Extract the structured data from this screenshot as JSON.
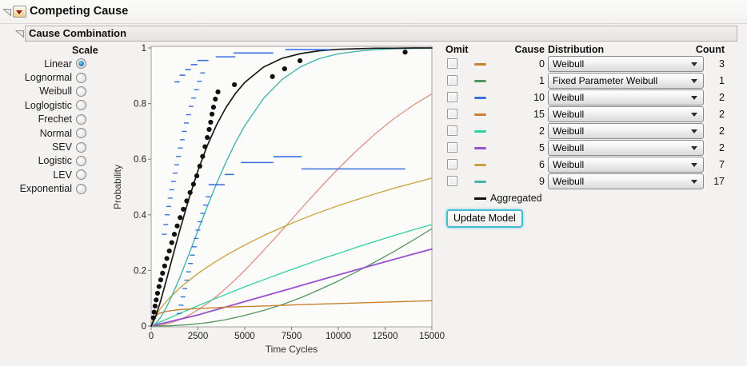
{
  "header": {
    "title": "Competing Cause"
  },
  "section": {
    "title": "Cause Combination"
  },
  "scale_panel": {
    "title": "Scale",
    "options": [
      {
        "label": "Linear",
        "selected": true
      },
      {
        "label": "Lognormal",
        "selected": false
      },
      {
        "label": "Weibull",
        "selected": false
      },
      {
        "label": "Loglogistic",
        "selected": false
      },
      {
        "label": "Frechet",
        "selected": false
      },
      {
        "label": "Normal",
        "selected": false
      },
      {
        "label": "SEV",
        "selected": false
      },
      {
        "label": "Logistic",
        "selected": false
      },
      {
        "label": "LEV",
        "selected": false
      },
      {
        "label": "Exponential",
        "selected": false
      }
    ]
  },
  "chart_data": {
    "type": "line",
    "xlabel": "Time Cycles",
    "ylabel": "Probability",
    "xlim": [
      0,
      15000
    ],
    "ylim": [
      0,
      1
    ],
    "xticks": [
      {
        "v": 0,
        "label": "0"
      },
      {
        "v": 2500,
        "label": "2500"
      },
      {
        "v": 5000,
        "label": "5000"
      },
      {
        "v": 7500,
        "label": "7500"
      },
      {
        "v": 10000,
        "label": "10000"
      },
      {
        "v": 12500,
        "label": "12500"
      },
      {
        "v": 15000,
        "label": "15000"
      }
    ],
    "yticks": [
      {
        "v": 0,
        "label": "0"
      },
      {
        "v": 0.2,
        "label": "0.2"
      },
      {
        "v": 0.4,
        "label": "0.4"
      },
      {
        "v": 0.6,
        "label": "0.6"
      },
      {
        "v": 0.8,
        "label": "0.8"
      },
      {
        "v": 1,
        "label": "1"
      }
    ],
    "grid": false,
    "series": [
      {
        "name": "Cause 15",
        "color": "#dd9282",
        "width": 1.3,
        "points": [
          [
            0,
            0
          ],
          [
            500,
            0.003
          ],
          [
            1000,
            0.01
          ],
          [
            1500,
            0.022
          ],
          [
            2000,
            0.038
          ],
          [
            2500,
            0.058
          ],
          [
            3000,
            0.081
          ],
          [
            3500,
            0.107
          ],
          [
            4000,
            0.136
          ],
          [
            4500,
            0.167
          ],
          [
            5000,
            0.2
          ],
          [
            6000,
            0.271
          ],
          [
            7000,
            0.345
          ],
          [
            8000,
            0.421
          ],
          [
            9000,
            0.495
          ],
          [
            10000,
            0.566
          ],
          [
            11000,
            0.632
          ],
          [
            12000,
            0.693
          ],
          [
            13000,
            0.747
          ],
          [
            14000,
            0.794
          ],
          [
            15000,
            0.835
          ]
        ]
      },
      {
        "name": "Cause 6",
        "color": "#c9a23d",
        "width": 1.3,
        "points": [
          [
            0,
            0
          ],
          [
            250,
            0.039
          ],
          [
            500,
            0.063
          ],
          [
            750,
            0.084
          ],
          [
            1000,
            0.102
          ],
          [
            1500,
            0.135
          ],
          [
            2000,
            0.163
          ],
          [
            2500,
            0.189
          ],
          [
            3000,
            0.212
          ],
          [
            3500,
            0.234
          ],
          [
            4000,
            0.254
          ],
          [
            4500,
            0.273
          ],
          [
            5000,
            0.291
          ],
          [
            6000,
            0.325
          ],
          [
            7000,
            0.355
          ],
          [
            8000,
            0.383
          ],
          [
            9000,
            0.409
          ],
          [
            10000,
            0.433
          ],
          [
            11000,
            0.455
          ],
          [
            12000,
            0.476
          ],
          [
            13000,
            0.496
          ],
          [
            14000,
            0.514
          ],
          [
            15000,
            0.532
          ]
        ]
      },
      {
        "name": "Cause 1",
        "color": "#55955b",
        "width": 1.3,
        "points": [
          [
            0,
            0
          ],
          [
            1000,
            0.001
          ],
          [
            2000,
            0.005
          ],
          [
            3000,
            0.012
          ],
          [
            4000,
            0.023
          ],
          [
            5000,
            0.038
          ],
          [
            6000,
            0.056
          ],
          [
            7000,
            0.077
          ],
          [
            8000,
            0.102
          ],
          [
            9000,
            0.131
          ],
          [
            10000,
            0.162
          ],
          [
            11000,
            0.196
          ],
          [
            12000,
            0.232
          ],
          [
            13000,
            0.269
          ],
          [
            14000,
            0.309
          ],
          [
            15000,
            0.35
          ]
        ]
      },
      {
        "name": "Cause 2",
        "color": "#2fd19d",
        "width": 1.3,
        "points": [
          [
            0,
            0
          ],
          [
            1000,
            0.03
          ],
          [
            2000,
            0.059
          ],
          [
            3000,
            0.087
          ],
          [
            4000,
            0.114
          ],
          [
            5000,
            0.141
          ],
          [
            6000,
            0.166
          ],
          [
            7000,
            0.191
          ],
          [
            8000,
            0.215
          ],
          [
            9000,
            0.239
          ],
          [
            10000,
            0.261
          ],
          [
            11000,
            0.284
          ],
          [
            12000,
            0.305
          ],
          [
            13000,
            0.326
          ],
          [
            14000,
            0.346
          ],
          [
            15000,
            0.365
          ]
        ]
      },
      {
        "name": "Cause 5",
        "color": "#9b50d0",
        "width": 1.8,
        "points": [
          [
            0,
            0
          ],
          [
            2500,
            0.04
          ],
          [
            5000,
            0.088
          ],
          [
            7500,
            0.136
          ],
          [
            10000,
            0.184
          ],
          [
            12500,
            0.231
          ],
          [
            15000,
            0.277
          ]
        ]
      },
      {
        "name": "Cause 0",
        "color": "#c8812f",
        "width": 1.4,
        "points": [
          [
            0,
            0
          ],
          [
            100,
            0.022
          ],
          [
            200,
            0.034
          ],
          [
            400,
            0.045
          ],
          [
            700,
            0.051
          ],
          [
            1000,
            0.055
          ],
          [
            1500,
            0.059
          ],
          [
            2500,
            0.063
          ],
          [
            4000,
            0.068
          ],
          [
            6000,
            0.072
          ],
          [
            8000,
            0.077
          ],
          [
            10000,
            0.081
          ],
          [
            12500,
            0.086
          ],
          [
            15000,
            0.091
          ]
        ]
      },
      {
        "name": "Cause 9",
        "color": "#45b4af",
        "width": 1.4,
        "points": [
          [
            0,
            0
          ],
          [
            250,
            0.01
          ],
          [
            500,
            0.031
          ],
          [
            750,
            0.059
          ],
          [
            1000,
            0.092
          ],
          [
            1500,
            0.169
          ],
          [
            2000,
            0.255
          ],
          [
            2500,
            0.343
          ],
          [
            3000,
            0.43
          ],
          [
            3500,
            0.513
          ],
          [
            4000,
            0.59
          ],
          [
            4500,
            0.659
          ],
          [
            5000,
            0.72
          ],
          [
            6000,
            0.818
          ],
          [
            7000,
            0.887
          ],
          [
            8000,
            0.933
          ],
          [
            9000,
            0.962
          ],
          [
            10000,
            0.979
          ],
          [
            11000,
            0.988
          ],
          [
            12000,
            0.994
          ],
          [
            13000,
            0.997
          ],
          [
            14000,
            0.998
          ],
          [
            15000,
            0.999
          ]
        ]
      },
      {
        "name": "Aggregated",
        "color": "#1a1a1a",
        "width": 1.7,
        "points": [
          [
            0,
            0
          ],
          [
            250,
            0.036
          ],
          [
            500,
            0.089
          ],
          [
            750,
            0.149
          ],
          [
            1000,
            0.212
          ],
          [
            1500,
            0.337
          ],
          [
            2000,
            0.454
          ],
          [
            2500,
            0.559
          ],
          [
            3000,
            0.649
          ],
          [
            3500,
            0.724
          ],
          [
            4000,
            0.786
          ],
          [
            4500,
            0.836
          ],
          [
            5000,
            0.876
          ],
          [
            6000,
            0.931
          ],
          [
            7000,
            0.963
          ],
          [
            8000,
            0.98
          ],
          [
            9000,
            0.99
          ],
          [
            10000,
            0.995
          ],
          [
            11000,
            0.997
          ],
          [
            12000,
            0.999
          ],
          [
            13000,
            0.999
          ],
          [
            14000,
            1
          ],
          [
            15000,
            1
          ]
        ]
      }
    ],
    "nonparametric": {
      "color": "#3b70dc",
      "dot_color": "#111111",
      "segments": [
        [
          1250,
          1520,
          0.878
        ],
        [
          1520,
          1820,
          0.902
        ],
        [
          1820,
          2120,
          0.922
        ],
        [
          2120,
          2470,
          0.94
        ],
        [
          2470,
          3060,
          0.955
        ],
        [
          3450,
          4500,
          0.968
        ],
        [
          4400,
          6520,
          0.982
        ],
        [
          7170,
          9550,
          0.994
        ],
        [
          3070,
          3930,
          0.508
        ],
        [
          3930,
          4420,
          0.545
        ],
        [
          4800,
          6530,
          0.588
        ],
        [
          6530,
          8040,
          0.609
        ],
        [
          8040,
          13570,
          0.565
        ]
      ],
      "upper_ticks": [
        [
          700,
          0.33
        ],
        [
          780,
          0.365
        ],
        [
          860,
          0.4
        ],
        [
          940,
          0.43
        ],
        [
          1020,
          0.46
        ],
        [
          1100,
          0.49
        ],
        [
          1190,
          0.52
        ],
        [
          1280,
          0.55
        ],
        [
          1370,
          0.58
        ],
        [
          1460,
          0.61
        ],
        [
          1560,
          0.64
        ],
        [
          1660,
          0.67
        ],
        [
          1770,
          0.7
        ],
        [
          1880,
          0.73
        ],
        [
          2000,
          0.76
        ],
        [
          2130,
          0.79
        ],
        [
          2270,
          0.82
        ],
        [
          2420,
          0.85
        ],
        [
          2580,
          0.88
        ],
        [
          2750,
          0.91
        ]
      ],
      "lower_ticks": [
        [
          1500,
          0.045
        ],
        [
          1600,
          0.075
        ],
        [
          1700,
          0.105
        ],
        [
          1800,
          0.135
        ],
        [
          1900,
          0.165
        ],
        [
          2000,
          0.195
        ],
        [
          2100,
          0.225
        ],
        [
          2200,
          0.255
        ],
        [
          2300,
          0.285
        ],
        [
          2400,
          0.315
        ],
        [
          2500,
          0.345
        ],
        [
          2620,
          0.375
        ],
        [
          2750,
          0.405
        ],
        [
          2900,
          0.435
        ],
        [
          3050,
          0.465
        ]
      ],
      "dots": [
        [
          120,
          0.03
        ],
        [
          160,
          0.05
        ],
        [
          210,
          0.072
        ],
        [
          270,
          0.094
        ],
        [
          340,
          0.118
        ],
        [
          420,
          0.142
        ],
        [
          510,
          0.166
        ],
        [
          610,
          0.19
        ],
        [
          720,
          0.216
        ],
        [
          840,
          0.243
        ],
        [
          970,
          0.27
        ],
        [
          1100,
          0.3
        ],
        [
          1240,
          0.33
        ],
        [
          1390,
          0.36
        ],
        [
          1550,
          0.39
        ],
        [
          1720,
          0.42
        ],
        [
          1900,
          0.45
        ],
        [
          2080,
          0.48
        ],
        [
          2260,
          0.51
        ],
        [
          2440,
          0.54
        ],
        [
          2600,
          0.575
        ],
        [
          2750,
          0.61
        ],
        [
          2880,
          0.645
        ],
        [
          3000,
          0.678
        ],
        [
          3100,
          0.707
        ],
        [
          3180,
          0.733
        ],
        [
          3250,
          0.762
        ],
        [
          3330,
          0.787
        ],
        [
          3430,
          0.816
        ],
        [
          3570,
          0.842
        ],
        [
          4450,
          0.868
        ],
        [
          6480,
          0.897
        ],
        [
          7130,
          0.925
        ],
        [
          7950,
          0.954
        ],
        [
          13570,
          0.985
        ]
      ]
    }
  },
  "cause_table": {
    "headers": {
      "omit": "Omit",
      "cause": "Cause",
      "distribution": "Distribution",
      "count": "Count"
    },
    "rows": [
      {
        "cause": "0",
        "color": "#c8812f",
        "distribution": "Weibull",
        "count": "3",
        "omitted": false
      },
      {
        "cause": "1",
        "color": "#55955b",
        "distribution": "Fixed Parameter Weibull",
        "count": "1",
        "omitted": false
      },
      {
        "cause": "10",
        "color": "#3b70dc",
        "distribution": "Weibull",
        "count": "2",
        "omitted": false
      },
      {
        "cause": "15",
        "color": "#cd7f2d",
        "distribution": "Weibull",
        "count": "2",
        "omitted": false
      },
      {
        "cause": "2",
        "color": "#2fd19d",
        "distribution": "Weibull",
        "count": "2",
        "omitted": false
      },
      {
        "cause": "5",
        "color": "#9b50d0",
        "distribution": "Weibull",
        "count": "2",
        "omitted": false
      },
      {
        "cause": "6",
        "color": "#c9a23d",
        "distribution": "Weibull",
        "count": "7",
        "omitted": false
      },
      {
        "cause": "9",
        "color": "#45b4af",
        "distribution": "Weibull",
        "count": "17",
        "omitted": false
      }
    ],
    "aggregated": {
      "label": "Aggregated",
      "color": "#111111"
    }
  },
  "update_button_label": "Update Model"
}
